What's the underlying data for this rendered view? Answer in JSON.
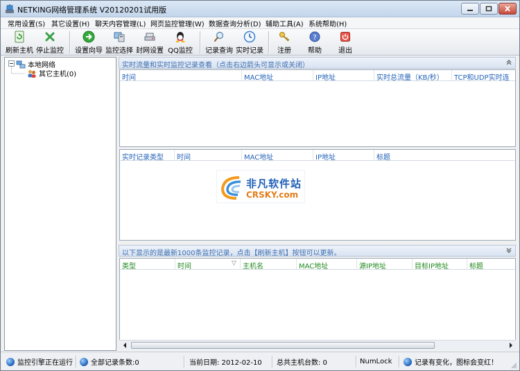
{
  "window": {
    "title": "NETKING网络管理系统 V20120201试用版"
  },
  "menu": [
    {
      "label": "常用设置(S)"
    },
    {
      "label": "其它设置(H)"
    },
    {
      "label": "聊天内容管理(L)"
    },
    {
      "label": "网页监控管理(W)"
    },
    {
      "label": "数据查询分析(D)"
    },
    {
      "label": "辅助工具(A)"
    },
    {
      "label": "系统帮助(H)"
    }
  ],
  "toolbar": [
    {
      "label": "刷新主机",
      "icon": "refresh-icon"
    },
    {
      "label": "停止监控",
      "icon": "stop-icon"
    },
    {
      "label": "设置向导",
      "icon": "wizard-icon"
    },
    {
      "label": "监控选择",
      "icon": "monitor-select-icon"
    },
    {
      "label": "封网设置",
      "icon": "network-block-icon"
    },
    {
      "label": "QQ监控",
      "icon": "qq-icon"
    },
    {
      "label": "记录查询",
      "icon": "search-icon"
    },
    {
      "label": "实时记录",
      "icon": "clock-icon"
    },
    {
      "label": "注册",
      "icon": "key-icon"
    },
    {
      "label": "帮助",
      "icon": "help-icon"
    },
    {
      "label": "退出",
      "icon": "exit-icon"
    }
  ],
  "tree": {
    "root": "本地网络",
    "child": "其它主机(0)"
  },
  "traffic_panel": {
    "header": "实时流量和实时监控记录查看（点击右边箭头可显示或关闭）",
    "columns": [
      "时间",
      "MAC地址",
      "IP地址",
      "实时总流量（KB/秒）",
      "TCP和UDP实时连"
    ]
  },
  "realtime_panel": {
    "columns": [
      "实时记录类型",
      "时间",
      "MAC地址",
      "IP地址",
      "标题"
    ]
  },
  "records_panel": {
    "header": "以下显示的是最新1000条监控记录，点击【刷新主机】按钮可以更新。",
    "columns": [
      "类型",
      "时间",
      "主机名",
      "MAC地址",
      "源IP地址",
      "目标IP地址",
      "标题"
    ],
    "sort_indicator": "▽"
  },
  "watermark": {
    "name": "非凡软件站",
    "site": "CRSKY.com"
  },
  "status": {
    "engine": "监控引擎正在运行",
    "total_records": "全部记录条数:0",
    "current_date": "当前日期:  2012-02-10",
    "host_count": "总共主机台数:  0",
    "numlock": "NumLock",
    "notice": "记录有变化，图标会变红！"
  },
  "colors": {
    "accent_blue": "#2462b8",
    "header_green": "#1f8a1f",
    "pane_header_text": "#3f6fb0"
  }
}
